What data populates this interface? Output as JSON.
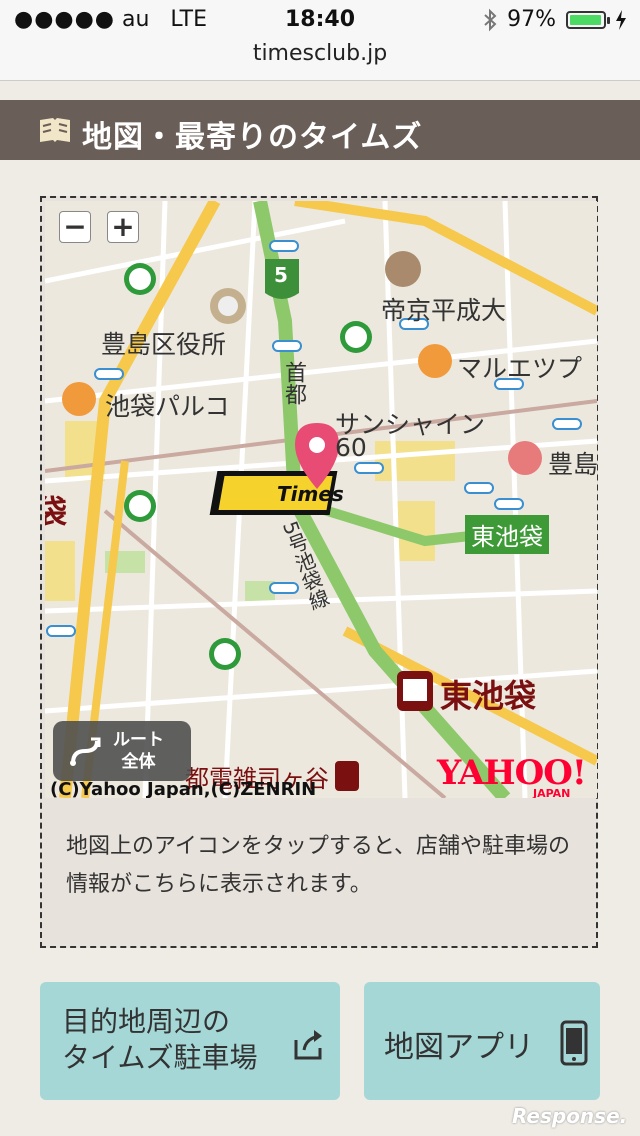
{
  "status_bar": {
    "signal": "●●●●●",
    "carrier": "au",
    "network": "LTE",
    "time": "18:40",
    "battery": "97%",
    "battery_level": 0.97
  },
  "browser": {
    "url": "timesclub.jp"
  },
  "section": {
    "title": "地図・最寄りのタイムズ",
    "icon": "map-book-icon"
  },
  "map": {
    "zoom_out": "−",
    "zoom_in": "+",
    "route_top": "ルート",
    "route_bottom": "全体",
    "copyright": "(C)Yahoo Japan,(C)ZENRIN",
    "yahoo": "YAHOO!",
    "yahoo_sub": "JAPAN",
    "labels": {
      "teikyo": "帝京平成大",
      "toshima_office": "豊島区役所",
      "maruetsu": "マルエツプ",
      "parco": "池袋パルコ",
      "sunshine": "サンシャイン",
      "sunshine_60": "60",
      "toshima_right": "豊島",
      "ikebukuro_left": "袋",
      "higashi_ikebukuro_green": "東池袋",
      "higashi_ikebukuro_station": "東池袋",
      "metro_station": "都電雑司ヶ谷",
      "route_5": "5",
      "shuto": "首都",
      "ikebukuro_line": "5号池袋線"
    },
    "info": "地図上のアイコンをタップすると、店舗や駐車場の情報がこちらに表示されます。"
  },
  "buttons": {
    "destination": [
      "目的地周辺の",
      "タイムズ駐車場"
    ],
    "map_app": "地図アプリ"
  },
  "watermark": "Response."
}
